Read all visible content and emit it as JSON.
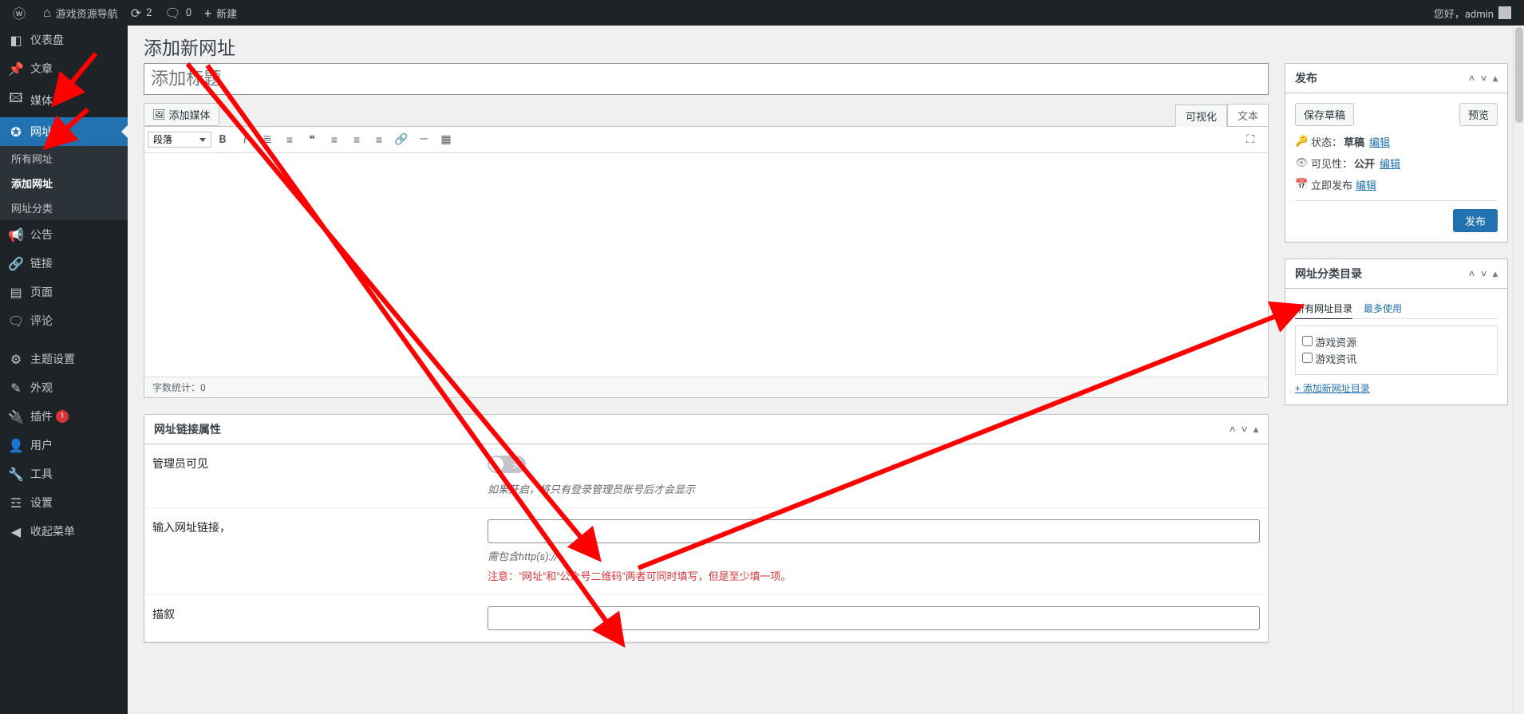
{
  "adminbar": {
    "site_name": "游戏资源导航",
    "updates": "2",
    "comments": "0",
    "new": "新建",
    "greeting": "您好，admin"
  },
  "menu": {
    "dashboard": "仪表盘",
    "posts": "文章",
    "media": "媒体",
    "links": "网址",
    "links_sub": {
      "all": "所有网址",
      "add": "添加网址",
      "cat": "网址分类"
    },
    "notice": "公告",
    "wp_links": "链接",
    "pages": "页面",
    "comments": "评论",
    "theme_opts": "主题设置",
    "appearance": "外观",
    "plugins": "插件",
    "plugins_badge": "1",
    "users": "用户",
    "tools": "工具",
    "settings": "设置",
    "collapse": "收起菜单"
  },
  "page": {
    "title": "添加新网址",
    "title_placeholder": "添加标题"
  },
  "editor": {
    "add_media": "添加媒体",
    "tab_visual": "可视化",
    "tab_text": "文本",
    "format_select": "段落",
    "word_count_label": "字数统计：",
    "word_count_value": "0"
  },
  "link_props": {
    "box_title": "网址链接属性",
    "admin_visible": {
      "label": "管理员可见",
      "toggle_off": "关",
      "desc": "如果开启，将只有登录管理员账号后才会显示"
    },
    "url": {
      "label": "输入网址链接，",
      "desc": "需包含http(s)://",
      "warn": "注意：\"网址\"和\"公众号二维码\"两者可同时填写，但是至少填一项。"
    },
    "desc": {
      "label": "描叙"
    }
  },
  "publish": {
    "title": "发布",
    "save_draft": "保存草稿",
    "preview": "预览",
    "status_label": "状态：",
    "status_value": "草稿",
    "visibility_label": "可见性：",
    "visibility_value": "公开",
    "schedule_label": "立即发布",
    "edit": "编辑",
    "publish_btn": "发布"
  },
  "category": {
    "title": "网址分类目录",
    "tab_all": "所有网址目录",
    "tab_most": "最多使用",
    "items": [
      "游戏资源",
      "游戏资讯"
    ],
    "add_new": "+ 添加新网址目录"
  }
}
